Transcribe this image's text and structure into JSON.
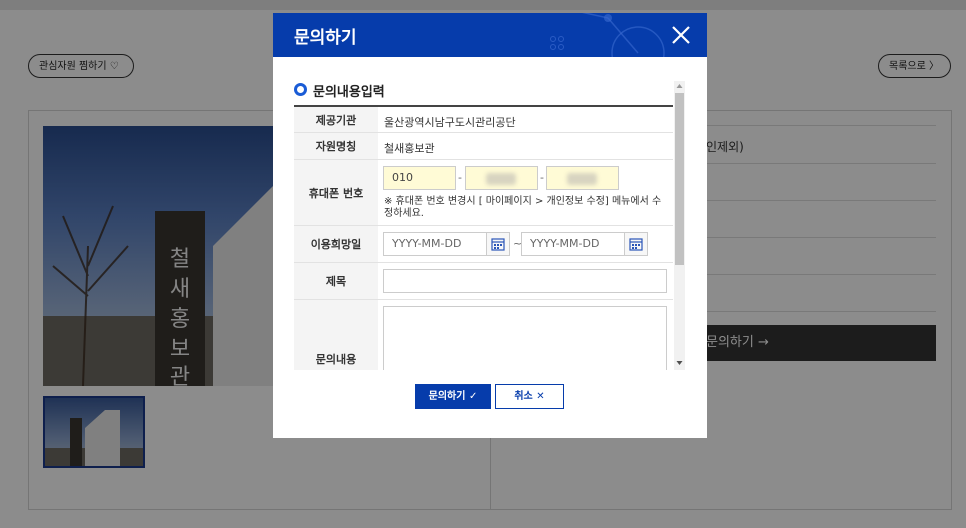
{
  "background": {
    "wishlist_button": "관심자원 찜하기 ♡",
    "list_button": "목록으로 〉",
    "right_panel_text": "인제외)",
    "right_panel_button": "문의하기 →"
  },
  "modal": {
    "title": "문의하기",
    "close_icon": "close-icon",
    "section_title": "문의내용입력",
    "rows": {
      "provider": {
        "label": "제공기관",
        "value": "울산광역시남구도시관리공단"
      },
      "resource": {
        "label": "자원명칭",
        "value": "철새홍보관"
      },
      "phone": {
        "label": "휴대폰 번호",
        "part1": "010",
        "sep": "-",
        "note": "※ 휴대폰 번호 변경시 [ 마이페이지 > 개인정보 수정] 메뉴에서 수정하세요."
      },
      "period": {
        "label": "이용희망일",
        "start_placeholder": "YYYY-MM-DD",
        "end_placeholder": "YYYY-MM-DD",
        "sep": "~"
      },
      "subject": {
        "label": "제목",
        "value": ""
      },
      "content": {
        "label": "문의내용",
        "value": ""
      }
    },
    "submit_button": "문의하기 ✓",
    "cancel_button": "취소 ✕"
  },
  "colors": {
    "brand_blue": "#063cab",
    "input_yellow": "#fffbd6",
    "overlay": "rgba(0,0,0,0.45)"
  }
}
